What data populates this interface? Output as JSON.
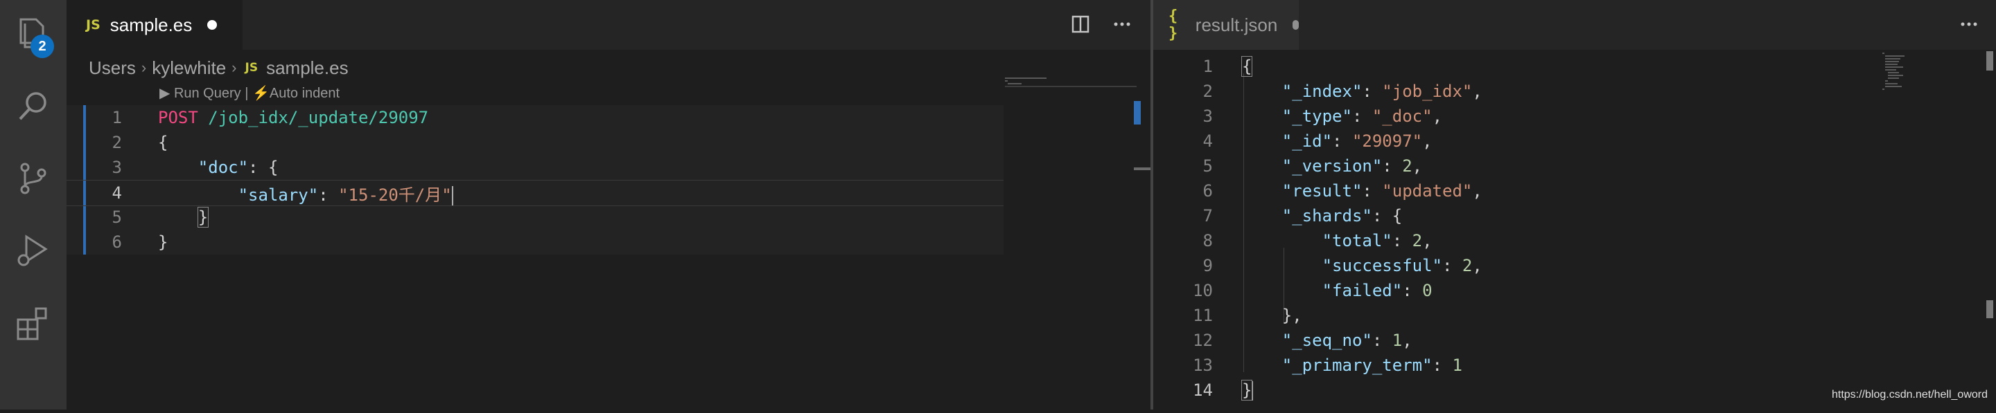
{
  "activity_bar": {
    "explorer_badge": "2",
    "icons": [
      "files-icon",
      "search-icon",
      "source-control-icon",
      "run-debug-icon",
      "extensions-icon"
    ]
  },
  "editor_left": {
    "tab": {
      "icon": "JS",
      "label": "sample.es"
    },
    "breadcrumb": [
      "Users",
      "kylewhite",
      "sample.es"
    ],
    "breadcrumb_file_icon": "JS",
    "codelens": {
      "run": "▶ Run Query",
      "sep": "|",
      "auto": "⚡Auto indent"
    },
    "lines": [
      {
        "n": "1",
        "method": "POST",
        "path": " /job_idx/_update/29097"
      },
      {
        "n": "2",
        "text": "{"
      },
      {
        "n": "3",
        "indent": "    ",
        "key": "\"doc\"",
        "rest": ": {"
      },
      {
        "n": "4",
        "indent": "        ",
        "key": "\"salary\"",
        "colon": ": ",
        "value": "\"15-20千/月\""
      },
      {
        "n": "5",
        "indent": "    ",
        "text": "}"
      },
      {
        "n": "6",
        "text": "}"
      }
    ]
  },
  "editor_right": {
    "tab": {
      "icon": "{ }",
      "label": "result.json"
    },
    "lines": [
      {
        "n": "1",
        "parts": [
          [
            "punc",
            "{"
          ]
        ]
      },
      {
        "n": "2",
        "parts": [
          [
            "punc",
            "    "
          ],
          [
            "key",
            "\"_index\""
          ],
          [
            "punc",
            ": "
          ],
          [
            "str",
            "\"job_idx\""
          ],
          [
            "punc",
            ","
          ]
        ]
      },
      {
        "n": "3",
        "parts": [
          [
            "punc",
            "    "
          ],
          [
            "key",
            "\"_type\""
          ],
          [
            "punc",
            ": "
          ],
          [
            "str",
            "\"_doc\""
          ],
          [
            "punc",
            ","
          ]
        ]
      },
      {
        "n": "4",
        "parts": [
          [
            "punc",
            "    "
          ],
          [
            "key",
            "\"_id\""
          ],
          [
            "punc",
            ": "
          ],
          [
            "str",
            "\"29097\""
          ],
          [
            "punc",
            ","
          ]
        ]
      },
      {
        "n": "5",
        "parts": [
          [
            "punc",
            "    "
          ],
          [
            "key",
            "\"_version\""
          ],
          [
            "punc",
            ": "
          ],
          [
            "num",
            "2"
          ],
          [
            "punc",
            ","
          ]
        ]
      },
      {
        "n": "6",
        "parts": [
          [
            "punc",
            "    "
          ],
          [
            "key",
            "\"result\""
          ],
          [
            "punc",
            ": "
          ],
          [
            "str",
            "\"updated\""
          ],
          [
            "punc",
            ","
          ]
        ]
      },
      {
        "n": "7",
        "parts": [
          [
            "punc",
            "    "
          ],
          [
            "key",
            "\"_shards\""
          ],
          [
            "punc",
            ": {"
          ]
        ]
      },
      {
        "n": "8",
        "parts": [
          [
            "punc",
            "        "
          ],
          [
            "key",
            "\"total\""
          ],
          [
            "punc",
            ": "
          ],
          [
            "num",
            "2"
          ],
          [
            "punc",
            ","
          ]
        ]
      },
      {
        "n": "9",
        "parts": [
          [
            "punc",
            "        "
          ],
          [
            "key",
            "\"successful\""
          ],
          [
            "punc",
            ": "
          ],
          [
            "num",
            "2"
          ],
          [
            "punc",
            ","
          ]
        ]
      },
      {
        "n": "10",
        "parts": [
          [
            "punc",
            "        "
          ],
          [
            "key",
            "\"failed\""
          ],
          [
            "punc",
            ": "
          ],
          [
            "num",
            "0"
          ]
        ]
      },
      {
        "n": "11",
        "parts": [
          [
            "punc",
            "    },"
          ]
        ]
      },
      {
        "n": "12",
        "parts": [
          [
            "punc",
            "    "
          ],
          [
            "key",
            "\"_seq_no\""
          ],
          [
            "punc",
            ": "
          ],
          [
            "num",
            "1"
          ],
          [
            "punc",
            ","
          ]
        ]
      },
      {
        "n": "13",
        "parts": [
          [
            "punc",
            "    "
          ],
          [
            "key",
            "\"_primary_term\""
          ],
          [
            "punc",
            ": "
          ],
          [
            "num",
            "1"
          ]
        ]
      },
      {
        "n": "14",
        "parts": [
          [
            "punc",
            "}"
          ]
        ]
      }
    ]
  },
  "watermark": "https://blog.csdn.net/hell_oword",
  "colors": {
    "accent": "#2f6db5",
    "badge": "#0e70c0",
    "method": "#f34882",
    "key": "#9cdcfe",
    "string": "#ce9178",
    "number": "#b5cea8",
    "url": "#4ec9b0"
  }
}
